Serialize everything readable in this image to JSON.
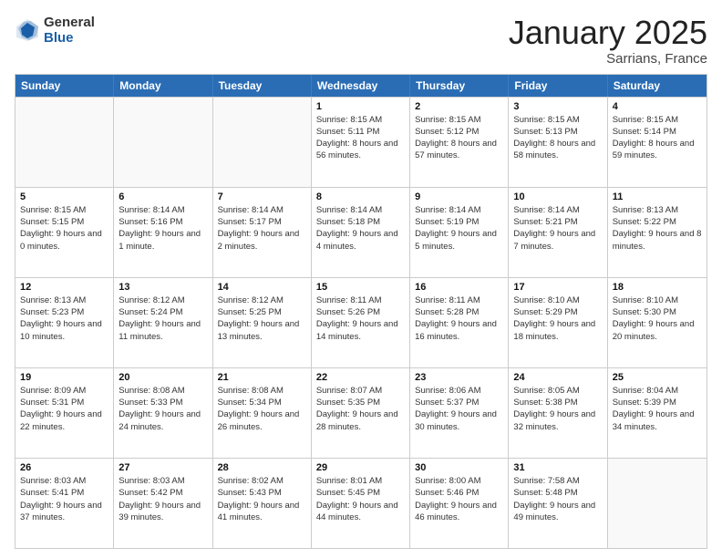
{
  "logo": {
    "general": "General",
    "blue": "Blue"
  },
  "title": "January 2025",
  "subtitle": "Sarrians, France",
  "days": [
    "Sunday",
    "Monday",
    "Tuesday",
    "Wednesday",
    "Thursday",
    "Friday",
    "Saturday"
  ],
  "weeks": [
    [
      {
        "day": "",
        "info": ""
      },
      {
        "day": "",
        "info": ""
      },
      {
        "day": "",
        "info": ""
      },
      {
        "day": "1",
        "info": "Sunrise: 8:15 AM\nSunset: 5:11 PM\nDaylight: 8 hours and 56 minutes."
      },
      {
        "day": "2",
        "info": "Sunrise: 8:15 AM\nSunset: 5:12 PM\nDaylight: 8 hours and 57 minutes."
      },
      {
        "day": "3",
        "info": "Sunrise: 8:15 AM\nSunset: 5:13 PM\nDaylight: 8 hours and 58 minutes."
      },
      {
        "day": "4",
        "info": "Sunrise: 8:15 AM\nSunset: 5:14 PM\nDaylight: 8 hours and 59 minutes."
      }
    ],
    [
      {
        "day": "5",
        "info": "Sunrise: 8:15 AM\nSunset: 5:15 PM\nDaylight: 9 hours and 0 minutes."
      },
      {
        "day": "6",
        "info": "Sunrise: 8:14 AM\nSunset: 5:16 PM\nDaylight: 9 hours and 1 minute."
      },
      {
        "day": "7",
        "info": "Sunrise: 8:14 AM\nSunset: 5:17 PM\nDaylight: 9 hours and 2 minutes."
      },
      {
        "day": "8",
        "info": "Sunrise: 8:14 AM\nSunset: 5:18 PM\nDaylight: 9 hours and 4 minutes."
      },
      {
        "day": "9",
        "info": "Sunrise: 8:14 AM\nSunset: 5:19 PM\nDaylight: 9 hours and 5 minutes."
      },
      {
        "day": "10",
        "info": "Sunrise: 8:14 AM\nSunset: 5:21 PM\nDaylight: 9 hours and 7 minutes."
      },
      {
        "day": "11",
        "info": "Sunrise: 8:13 AM\nSunset: 5:22 PM\nDaylight: 9 hours and 8 minutes."
      }
    ],
    [
      {
        "day": "12",
        "info": "Sunrise: 8:13 AM\nSunset: 5:23 PM\nDaylight: 9 hours and 10 minutes."
      },
      {
        "day": "13",
        "info": "Sunrise: 8:12 AM\nSunset: 5:24 PM\nDaylight: 9 hours and 11 minutes."
      },
      {
        "day": "14",
        "info": "Sunrise: 8:12 AM\nSunset: 5:25 PM\nDaylight: 9 hours and 13 minutes."
      },
      {
        "day": "15",
        "info": "Sunrise: 8:11 AM\nSunset: 5:26 PM\nDaylight: 9 hours and 14 minutes."
      },
      {
        "day": "16",
        "info": "Sunrise: 8:11 AM\nSunset: 5:28 PM\nDaylight: 9 hours and 16 minutes."
      },
      {
        "day": "17",
        "info": "Sunrise: 8:10 AM\nSunset: 5:29 PM\nDaylight: 9 hours and 18 minutes."
      },
      {
        "day": "18",
        "info": "Sunrise: 8:10 AM\nSunset: 5:30 PM\nDaylight: 9 hours and 20 minutes."
      }
    ],
    [
      {
        "day": "19",
        "info": "Sunrise: 8:09 AM\nSunset: 5:31 PM\nDaylight: 9 hours and 22 minutes."
      },
      {
        "day": "20",
        "info": "Sunrise: 8:08 AM\nSunset: 5:33 PM\nDaylight: 9 hours and 24 minutes."
      },
      {
        "day": "21",
        "info": "Sunrise: 8:08 AM\nSunset: 5:34 PM\nDaylight: 9 hours and 26 minutes."
      },
      {
        "day": "22",
        "info": "Sunrise: 8:07 AM\nSunset: 5:35 PM\nDaylight: 9 hours and 28 minutes."
      },
      {
        "day": "23",
        "info": "Sunrise: 8:06 AM\nSunset: 5:37 PM\nDaylight: 9 hours and 30 minutes."
      },
      {
        "day": "24",
        "info": "Sunrise: 8:05 AM\nSunset: 5:38 PM\nDaylight: 9 hours and 32 minutes."
      },
      {
        "day": "25",
        "info": "Sunrise: 8:04 AM\nSunset: 5:39 PM\nDaylight: 9 hours and 34 minutes."
      }
    ],
    [
      {
        "day": "26",
        "info": "Sunrise: 8:03 AM\nSunset: 5:41 PM\nDaylight: 9 hours and 37 minutes."
      },
      {
        "day": "27",
        "info": "Sunrise: 8:03 AM\nSunset: 5:42 PM\nDaylight: 9 hours and 39 minutes."
      },
      {
        "day": "28",
        "info": "Sunrise: 8:02 AM\nSunset: 5:43 PM\nDaylight: 9 hours and 41 minutes."
      },
      {
        "day": "29",
        "info": "Sunrise: 8:01 AM\nSunset: 5:45 PM\nDaylight: 9 hours and 44 minutes."
      },
      {
        "day": "30",
        "info": "Sunrise: 8:00 AM\nSunset: 5:46 PM\nDaylight: 9 hours and 46 minutes."
      },
      {
        "day": "31",
        "info": "Sunrise: 7:58 AM\nSunset: 5:48 PM\nDaylight: 9 hours and 49 minutes."
      },
      {
        "day": "",
        "info": ""
      }
    ]
  ]
}
